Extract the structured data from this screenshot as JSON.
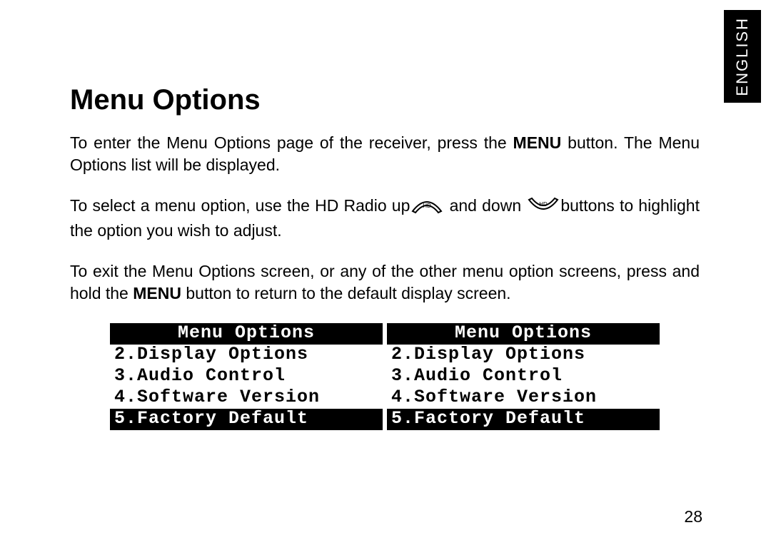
{
  "language_tab": "ENGLISH",
  "title": "Menu Options",
  "para1": {
    "pre": "To enter the Menu Options page of the receiver, press the ",
    "bold": "MENU",
    "post": " button. The Menu Options list will be displayed."
  },
  "para2": {
    "pre": "To select a menu option, use the HD Radio up",
    "mid": " and down ",
    "post": "buttons to highlight the option you wish to adjust."
  },
  "para3": {
    "pre": "To exit the Menu Options screen, or any of the other menu option screens, press and hold the ",
    "bold": "MENU",
    "post": " button to return to the default display screen."
  },
  "lcd_left": {
    "header": "Menu Options",
    "rows": [
      {
        "text": "2.Display Options",
        "inverted": false
      },
      {
        "text": "3.Audio Control",
        "inverted": false
      },
      {
        "text": "4.Software Version",
        "inverted": false
      },
      {
        "text": "5.Factory Default",
        "inverted": true
      }
    ]
  },
  "lcd_right": {
    "header": "Menu Options",
    "rows": [
      {
        "text": "2.Display Options",
        "inverted": false
      },
      {
        "text": "3.Audio Control",
        "inverted": false
      },
      {
        "text": "4.Software Version",
        "inverted": false
      },
      {
        "text": "5.Factory Default",
        "inverted": true
      }
    ]
  },
  "page_number": "28",
  "icons": {
    "up_button": "hd-up-icon",
    "down_button": "hd-down-icon"
  }
}
